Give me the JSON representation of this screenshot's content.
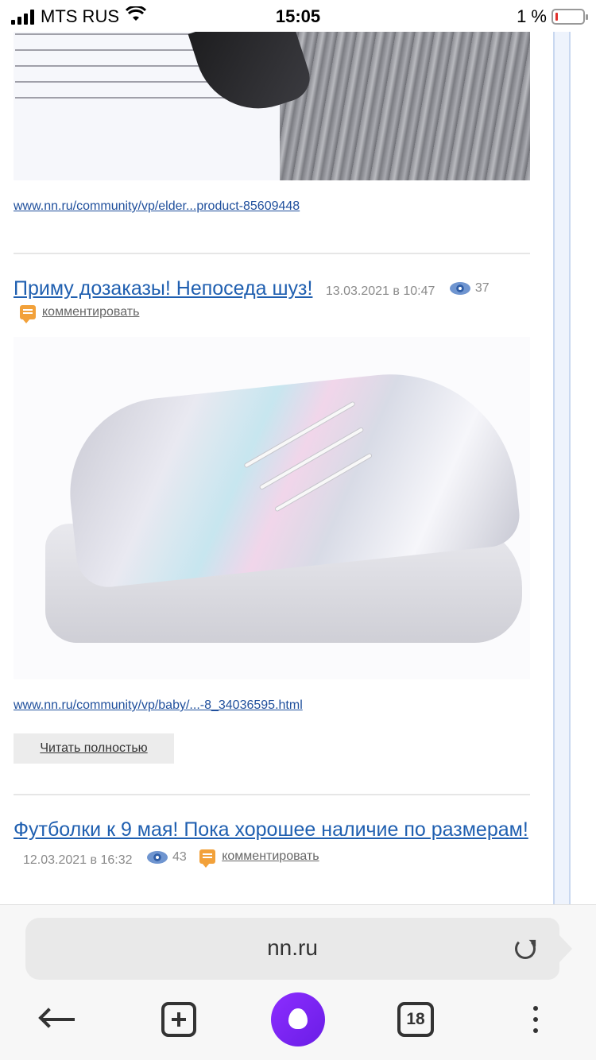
{
  "status_bar": {
    "carrier": "MTS RUS",
    "time": "15:05",
    "battery_percent": "1 %"
  },
  "feed": {
    "first_item": {
      "source_link": "www.nn.ru/community/vp/elder...product-85609448"
    },
    "post1": {
      "title": "Приму дозаказы! Непоседа шуз!",
      "date": "13.03.2021 в 10:47",
      "views": "37",
      "comment_label": "комментировать",
      "source_link": "www.nn.ru/community/vp/baby/...-8_34036595.html",
      "read_more": "Читать полностью"
    },
    "post2": {
      "title": "Футболки к 9 мая! Пока хорошее наличие по размерам!",
      "date": "12.03.2021 в 16:32",
      "views": "43",
      "comment_label": "комментировать"
    }
  },
  "browser": {
    "address": "nn.ru",
    "tab_count": "18",
    "icons": [
      "back-arrow-icon",
      "new-tab-icon",
      "alice-icon",
      "tabs-icon",
      "menu-icon",
      "reload-icon"
    ]
  },
  "colors": {
    "link": "#1f5fb0",
    "alice": "#8c2dff",
    "comment_icon": "#f2a13a"
  }
}
